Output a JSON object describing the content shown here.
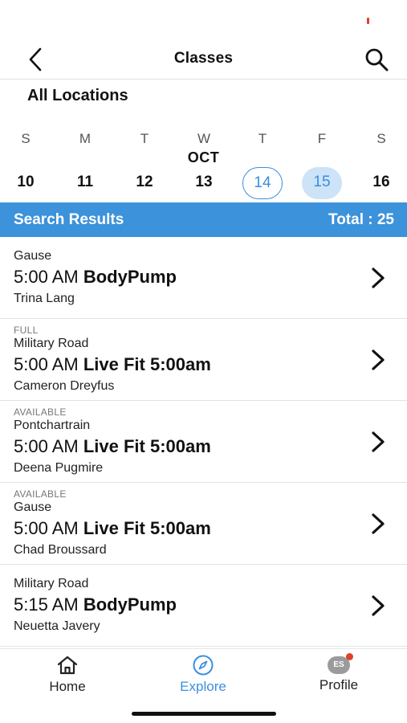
{
  "header": {
    "title": "Classes",
    "back_icon": "chevron-left-icon",
    "search_icon": "search-icon"
  },
  "location": "All Locations",
  "calendar": {
    "month": "OCT",
    "days": [
      {
        "letter": "S",
        "num": "10",
        "state": "normal"
      },
      {
        "letter": "M",
        "num": "11",
        "state": "normal"
      },
      {
        "letter": "T",
        "num": "12",
        "state": "normal"
      },
      {
        "letter": "W",
        "num": "13",
        "state": "normal"
      },
      {
        "letter": "T",
        "num": "14",
        "state": "today"
      },
      {
        "letter": "F",
        "num": "15",
        "state": "selected"
      },
      {
        "letter": "S",
        "num": "16",
        "state": "normal"
      }
    ],
    "accent_color": "#3a8fde"
  },
  "results": {
    "title": "Search Results",
    "total": "Total : 25",
    "bar_color": "#3c92db"
  },
  "classes": [
    {
      "status": "",
      "location": "Gause",
      "time": "5:00 AM",
      "name": "BodyPump",
      "instructor": "Trina Lang"
    },
    {
      "status": "FULL",
      "location": "Military Road",
      "time": "5:00 AM",
      "name": "Live Fit 5:00am",
      "instructor": "Cameron Dreyfus"
    },
    {
      "status": "AVAILABLE",
      "location": "Pontchartrain",
      "time": "5:00 AM",
      "name": "Live Fit 5:00am",
      "instructor": "Deena Pugmire"
    },
    {
      "status": "AVAILABLE",
      "location": "Gause",
      "time": "5:00 AM",
      "name": "Live Fit 5:00am",
      "instructor": "Chad Broussard"
    },
    {
      "status": "",
      "location": "Military Road",
      "time": "5:15 AM",
      "name": "BodyPump",
      "instructor": "Neuetta Javery"
    }
  ],
  "tabs": [
    {
      "label": "Home",
      "icon": "home-icon",
      "active": false
    },
    {
      "label": "Explore",
      "icon": "compass-icon",
      "active": true
    },
    {
      "label": "Profile",
      "icon": "avatar-icon",
      "avatar_initials": "ES",
      "active": false
    }
  ]
}
